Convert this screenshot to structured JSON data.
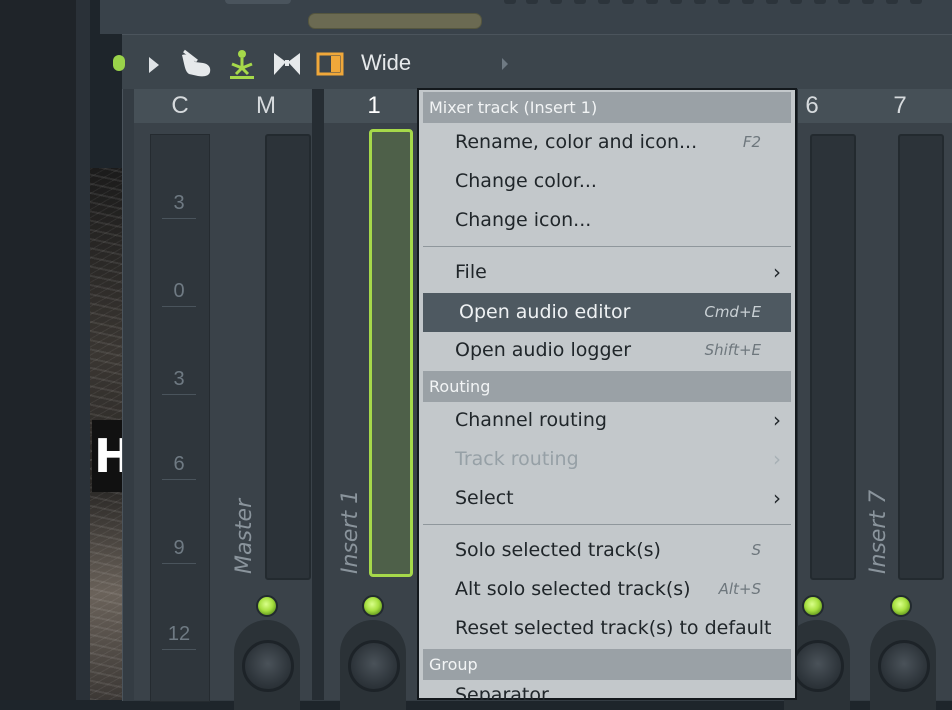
{
  "toolbar": {
    "view_label": "Wide"
  },
  "mixer": {
    "headers": [
      "C",
      "M",
      "1",
      "6",
      "7"
    ],
    "scale": [
      "3",
      "0",
      "3",
      "6",
      "9",
      "12"
    ],
    "strip_names": {
      "master": "Master",
      "insert1": "Insert 1",
      "insert7": "Insert 7"
    },
    "accent_color": "#a6d94a"
  },
  "background_photo_text": "H",
  "menu": {
    "title": "Mixer track (Insert 1)",
    "items": [
      {
        "label": "Rename, color and icon...",
        "shortcut": "F2"
      },
      {
        "label": "Change color..."
      },
      {
        "label": "Change icon..."
      },
      {
        "label": "File"
      },
      {
        "label": "Open audio editor",
        "shortcut": "Cmd+E"
      },
      {
        "label": "Open audio logger",
        "shortcut": "Shift+E"
      }
    ],
    "routing_header": "Routing",
    "routing_items": [
      {
        "label": "Channel routing"
      },
      {
        "label": "Track routing"
      },
      {
        "label": "Select"
      },
      {
        "label": "Solo selected track(s)",
        "shortcut": "S"
      },
      {
        "label": "Alt solo selected track(s)",
        "shortcut": "Alt+S"
      },
      {
        "label": "Reset selected track(s) to default"
      }
    ],
    "group_header": "Group",
    "group_items": [
      {
        "label": "Separator"
      }
    ]
  }
}
